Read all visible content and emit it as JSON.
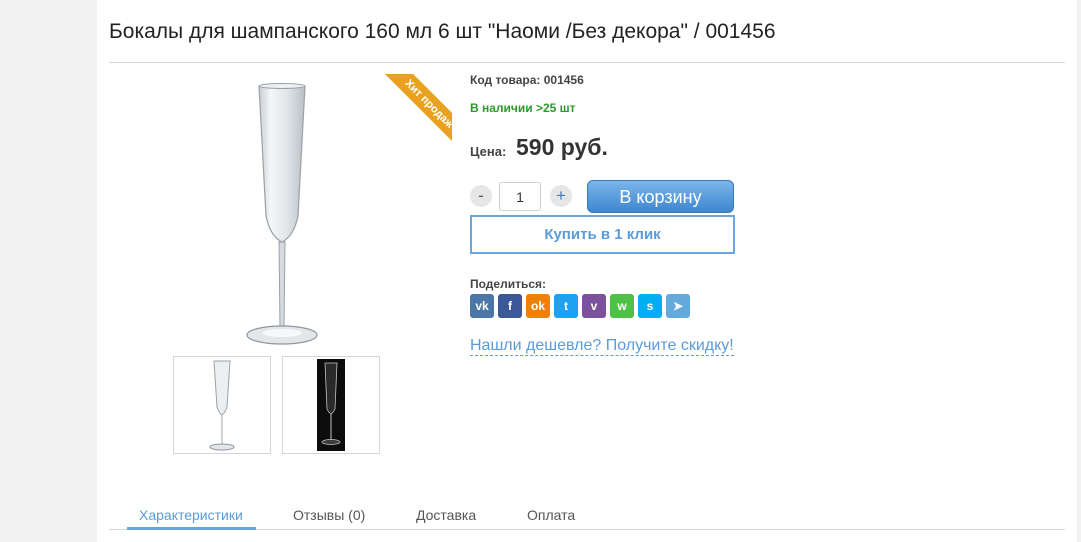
{
  "product": {
    "title": "Бокалы для шампанского 160 мл 6 шт \"Наоми /Без декора\" / 001456",
    "code_line": "Код товара: 001456",
    "stock": "В наличии >25 шт",
    "price_label": "Цена:",
    "price": "590 руб.",
    "badge": "Хит продаж",
    "quantity": "1"
  },
  "actions": {
    "minus": "-",
    "plus": "+",
    "add_to_cart": "В корзину",
    "buy_one_click": "Купить в 1 клик"
  },
  "share": {
    "label": "Поделиться:",
    "icons": [
      {
        "name": "vk-icon",
        "glyph": "vk",
        "color": "#4a76a8"
      },
      {
        "name": "facebook-icon",
        "glyph": "f",
        "color": "#3b5998"
      },
      {
        "name": "odnoklassniki-icon",
        "glyph": "ok",
        "color": "#ee8208"
      },
      {
        "name": "twitter-icon",
        "glyph": "t",
        "color": "#1da1f2"
      },
      {
        "name": "viber-icon",
        "glyph": "v",
        "color": "#7b519d"
      },
      {
        "name": "whatsapp-icon",
        "glyph": "w",
        "color": "#4dc247"
      },
      {
        "name": "skype-icon",
        "glyph": "s",
        "color": "#00aff0"
      },
      {
        "name": "telegram-icon",
        "glyph": "➤",
        "color": "#64a9dc"
      }
    ]
  },
  "cheaper_link": "Нашли дешевле? Получите скидку!",
  "tabs": [
    {
      "label": "Характеристики",
      "active": true
    },
    {
      "label": "Отзывы (0)",
      "active": false
    },
    {
      "label": "Доставка",
      "active": false
    },
    {
      "label": "Оплата",
      "active": false
    }
  ],
  "colors": {
    "accent": "#5a9bd8",
    "stock_green": "#2a9a2a",
    "badge_orange": "#e9a21f"
  }
}
